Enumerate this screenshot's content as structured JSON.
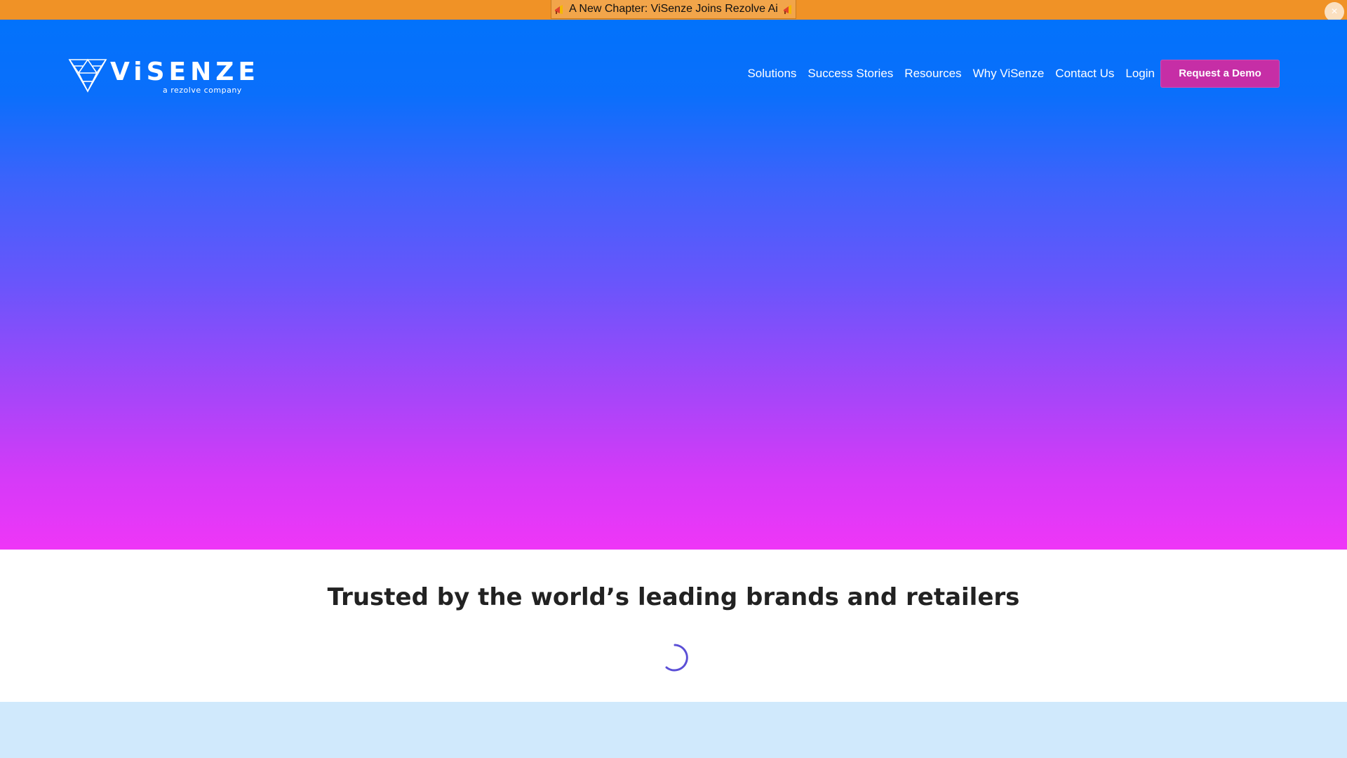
{
  "announcement": {
    "text": "A New Chapter: ViSenze Joins Rezolve Ai",
    "left_icon": "megaphone-icon",
    "right_icon": "megaphone-icon",
    "close_icon": "close-icon",
    "close_symbol": "×",
    "bar_color": "#f09226"
  },
  "header": {
    "logo": {
      "word": "ViSENZE",
      "subtitle": "a rezolve company"
    },
    "nav": [
      {
        "label": "Solutions"
      },
      {
        "label": "Success Stories"
      },
      {
        "label": "Resources"
      },
      {
        "label": "Why ViSenze"
      },
      {
        "label": "Contact Us"
      },
      {
        "label": "Login"
      }
    ],
    "cta": {
      "label": "Request a Demo",
      "color": "#c62ea6"
    }
  },
  "hero": {
    "gradient_top": "#0272fb",
    "gradient_bottom": "#ef36f7"
  },
  "trusted": {
    "title": "Trusted by the world’s leading brands and retailers",
    "loading_icon": "spinner-icon",
    "spinner_color": "#5b4fd6"
  },
  "next_section": {
    "background": "#d0e9fc"
  }
}
